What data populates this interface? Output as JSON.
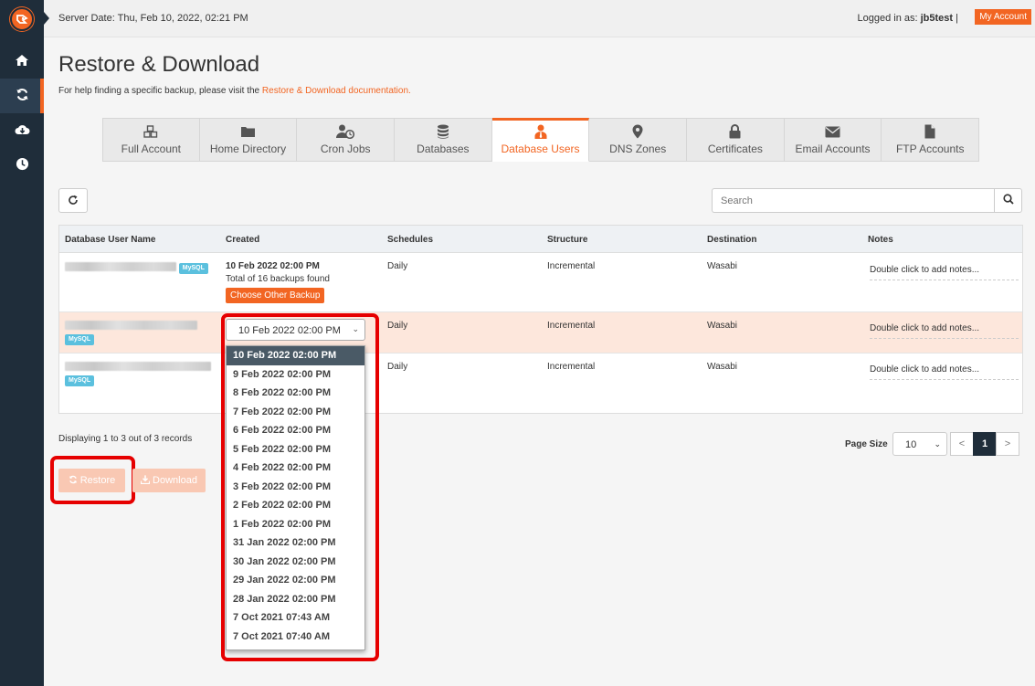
{
  "topbar": {
    "server_date": "Server Date: Thu, Feb 10, 2022, 02:21 PM",
    "logged_prefix": "Logged in as:",
    "username": "jb5test",
    "separator": "|",
    "my_account": "My Account"
  },
  "sidebar": {
    "items": [
      {
        "icon": "home-icon"
      },
      {
        "icon": "sync-icon",
        "active": true
      },
      {
        "icon": "cloud-download-icon"
      },
      {
        "icon": "clock-icon"
      }
    ]
  },
  "page": {
    "title": "Restore & Download",
    "help_text": "For help finding a specific backup, please visit the",
    "help_link": "Restore & Download documentation."
  },
  "tabs": [
    {
      "label": "Full Account",
      "icon": "cubes-icon"
    },
    {
      "label": "Home Directory",
      "icon": "folder-icon"
    },
    {
      "label": "Cron Jobs",
      "icon": "user-clock-icon"
    },
    {
      "label": "Databases",
      "icon": "database-icon"
    },
    {
      "label": "Database Users",
      "icon": "user-tie-icon",
      "active": true
    },
    {
      "label": "DNS Zones",
      "icon": "map-marker-icon"
    },
    {
      "label": "Certificates",
      "icon": "lock-icon"
    },
    {
      "label": "Email Accounts",
      "icon": "envelope-icon"
    },
    {
      "label": "FTP Accounts",
      "icon": "file-icon"
    }
  ],
  "search": {
    "placeholder": "Search"
  },
  "table": {
    "columns": [
      "Database User Name",
      "Created",
      "Schedules",
      "Structure",
      "Destination",
      "Notes"
    ],
    "rows": [
      {
        "badge": "MySQL",
        "created": "10 Feb 2022 02:00 PM",
        "total": "Total of 16 backups found",
        "choose": "Choose Other Backup",
        "schedule": "Daily",
        "structure": "Incremental",
        "destination": "Wasabi",
        "notes": "Double click to add notes..."
      },
      {
        "badge": "MySQL",
        "selected_backup": "10 Feb 2022 02:00 PM",
        "schedule": "Daily",
        "structure": "Incremental",
        "destination": "Wasabi",
        "notes": "Double click to add notes..."
      },
      {
        "badge": "MySQL",
        "schedule": "Daily",
        "structure": "Incremental",
        "destination": "Wasabi",
        "notes": "Double click to add notes..."
      }
    ]
  },
  "dropdown": {
    "options": [
      "10 Feb 2022 02:00 PM",
      "9 Feb 2022 02:00 PM",
      "8 Feb 2022 02:00 PM",
      "7 Feb 2022 02:00 PM",
      "6 Feb 2022 02:00 PM",
      "5 Feb 2022 02:00 PM",
      "4 Feb 2022 02:00 PM",
      "3 Feb 2022 02:00 PM",
      "2 Feb 2022 02:00 PM",
      "1 Feb 2022 02:00 PM",
      "31 Jan 2022 02:00 PM",
      "30 Jan 2022 02:00 PM",
      "29 Jan 2022 02:00 PM",
      "28 Jan 2022 02:00 PM",
      "7 Oct 2021 07:43 AM",
      "7 Oct 2021 07:40 AM"
    ]
  },
  "footer": {
    "display_text": "Displaying 1 to 3 out of 3 records",
    "restore": "Restore",
    "download": "Download",
    "page_size_label": "Page Size",
    "page_size": "10",
    "pager": {
      "prev": "<",
      "current": "1",
      "next": ">"
    }
  },
  "colors": {
    "accent": "#f26522",
    "sidebar": "#1f2d3a",
    "highlight": "#e60000",
    "badge": "#5bc0de"
  }
}
